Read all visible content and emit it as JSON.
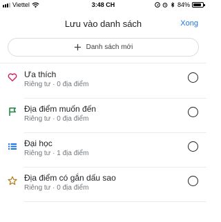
{
  "status_bar": {
    "carrier": "Viettel",
    "time": "3:48 CH",
    "battery_percent": "84%",
    "battery_level": 0.84,
    "icons": [
      "signal-icon",
      "wifi-icon",
      "location-icon",
      "alarm-icon",
      "bluetooth-icon",
      "battery-icon"
    ]
  },
  "header": {
    "title": "Lưu vào danh sách",
    "done_label": "Xong"
  },
  "new_list": {
    "label": "Danh sách mới",
    "icon": "plus-icon"
  },
  "lists": [
    {
      "title": "Ưa thích",
      "subtitle": "Riêng tư · 0 địa điểm",
      "icon": "heart-icon",
      "color": "#d81b60",
      "selected": false
    },
    {
      "title": "Địa điểm muốn đến",
      "subtitle": "Riêng tư · 0 địa điểm",
      "icon": "flag-icon",
      "color": "#188038",
      "selected": false
    },
    {
      "title": "Đại học",
      "subtitle": "Riêng tư · 1 địa điểm",
      "icon": "list-icon",
      "color": "#1a73e8",
      "selected": false
    },
    {
      "title": "Địa điểm có gắn dấu sao",
      "subtitle": "Riêng tư · 0 địa điểm",
      "icon": "star-icon",
      "color": "#b07a1a",
      "selected": false
    }
  ],
  "colors": {
    "accent": "#1a73e8",
    "divider": "#e8eaed"
  }
}
